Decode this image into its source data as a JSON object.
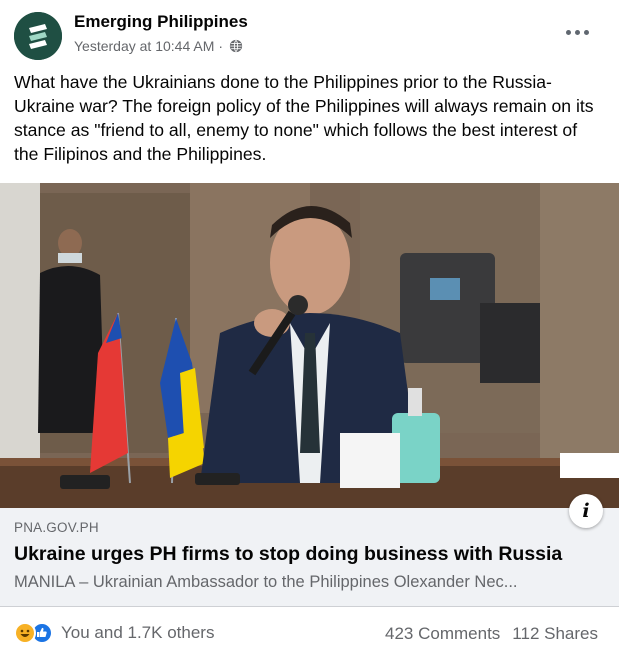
{
  "header": {
    "page_name": "Emerging Philippines",
    "timestamp": "Yesterday at 10:44 AM",
    "separator": "·",
    "privacy_icon": "globe-icon",
    "more_icon": "more-options-icon"
  },
  "post": {
    "text": "What have the Ukrainians done to the Philippines prior to the Russia-Ukraine war? The foreign policy of the Philippines will always remain on its stance as \"friend to all, enemy to none\" which follows the best interest of the Filipinos and the Philippines."
  },
  "link_preview": {
    "domain": "PNA.GOV.PH",
    "headline": "Ukraine urges PH firms to stop doing business with Russia",
    "snippet": "MANILA – Ukrainian Ambassador to the Philippines Olexander Nec...",
    "info_icon": "info-icon",
    "info_glyph": "i"
  },
  "footer": {
    "reaction_icons": [
      "haha-reaction-icon",
      "like-reaction-icon"
    ],
    "reaction_text": "You and 1.7K others",
    "comments": "423 Comments",
    "shares": "112 Shares"
  },
  "colors": {
    "avatar_bg": "#1f4f43",
    "link_box_bg": "#f0f2f5",
    "secondary_text": "#65676b",
    "like_blue": "#1b74e4",
    "haha_yellow": "#f7b125"
  }
}
